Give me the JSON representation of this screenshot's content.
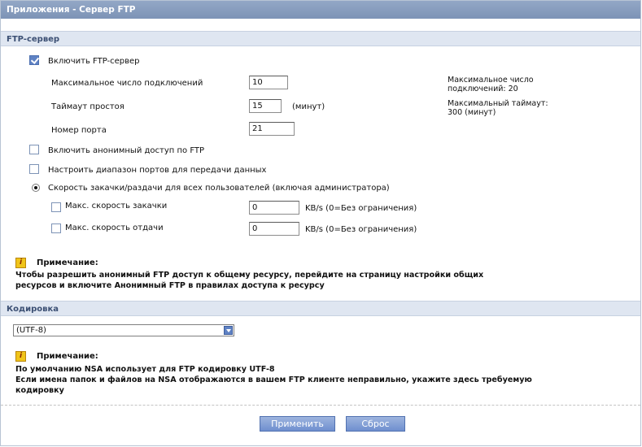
{
  "window": {
    "title": "Приложения - Сервер FTP"
  },
  "ftp": {
    "section_title": "FTP-сервер",
    "enable_label": "Включить FTP-сервер",
    "enable_checked": true,
    "max_conn_label": "Максимальное число подключений",
    "max_conn_value": "10",
    "max_conn_hint_line1": "Максимальное число",
    "max_conn_hint_line2": "подключений: 20",
    "idle_timeout_label": "Таймаут простоя",
    "idle_timeout_value": "15",
    "idle_timeout_unit": "(минут)",
    "idle_hint_line1": "Максимальный таймаут:",
    "idle_hint_line2": "300 (минут)",
    "port_label": "Номер порта",
    "port_value": "21",
    "anonymous_label": "Включить анонимный доступ по FTP",
    "anonymous_checked": false,
    "port_range_label": "Настроить диапазон портов для передачи данных",
    "port_range_checked": false,
    "speed_radio_label": "Скорость закачки/раздачи для всех пользователей (включая администратора)",
    "speed_radio_selected": true,
    "download_label": "Макс. скорость закачки",
    "download_value": "0",
    "download_unit": "KB/s (0=Без ограничения)",
    "upload_label": "Макс. скорость отдачи",
    "upload_value": "0",
    "upload_unit": "KB/s (0=Без ограничения)",
    "note_title": "Примечание:",
    "note_line1": "Чтобы разрешить анонимный FTP доступ к общему ресурсу, перейдите на страницу настройки общих",
    "note_line2": "ресурсов и включите Анонимный FTP в правилах доступа к ресурсу"
  },
  "encoding": {
    "section_title": "Кодировка",
    "selected": "(UTF-8)",
    "note_title": "Примечание:",
    "note_line1": "По умолчанию NSA использует для FTP кодировку UTF-8",
    "note_line2": "Если имена папок и файлов на NSA отображаются в вашем FTP клиенте неправильно, укажите здесь требуемую",
    "note_line3": "кодировку"
  },
  "buttons": {
    "apply": "Применить",
    "reset": "Сброс"
  },
  "colors": {
    "title_bar": "#8397bb",
    "section_bar": "#dfe6f1",
    "button": "#7f9bd4",
    "note_icon": "#f0c419"
  }
}
